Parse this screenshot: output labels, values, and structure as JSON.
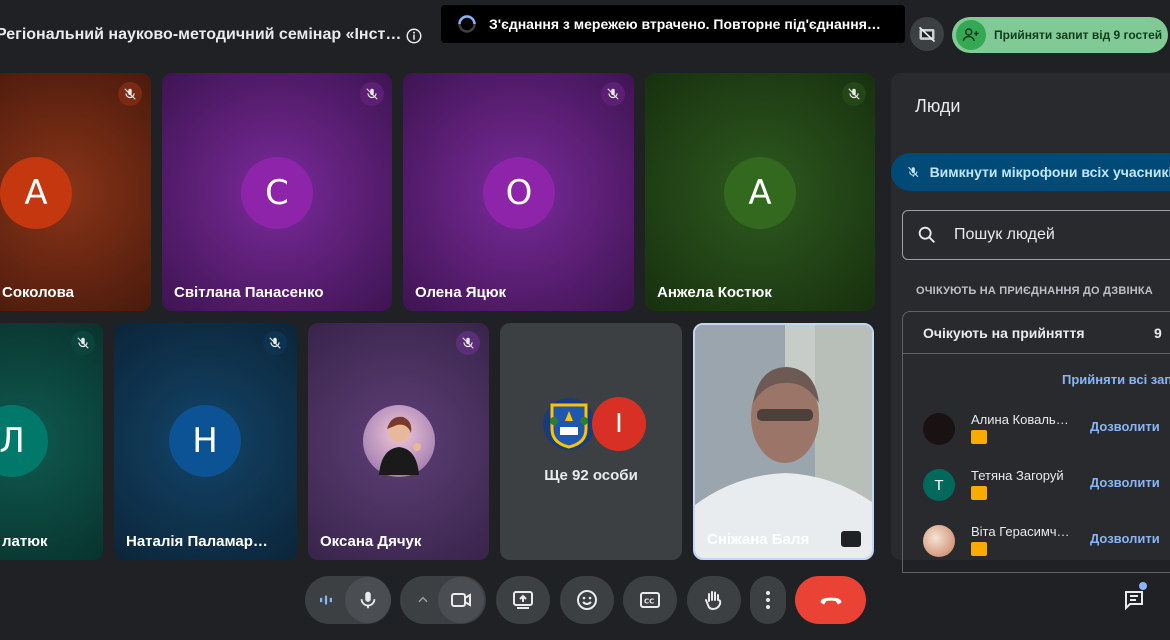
{
  "header": {
    "meeting_title": "Регіональний науково-методичний семінар «Інст…",
    "connection_banner": "З'єднання з мережею втрачено. Повторне під'єднання…",
    "admit_button": "Прийняти запит від 9 гостей"
  },
  "tiles": [
    {
      "name": "Соколова",
      "initial": "А",
      "color": "#c5370e",
      "bg": "#5e2412"
    },
    {
      "name": "Світлана Панасенко",
      "initial": "С",
      "color": "#8e24aa",
      "bg": "#4a1463"
    },
    {
      "name": "Олена Яцюк",
      "initial": "О",
      "color": "#8e24aa",
      "bg": "#4a1463"
    },
    {
      "name": "Анжела Костюк",
      "initial": "А",
      "color": "#33691e",
      "bg": "#1e3a14"
    },
    {
      "name": "латюк",
      "initial": "Л",
      "color": "#00796b",
      "bg": "#0b3d36"
    },
    {
      "name": "Наталія Паламар…",
      "initial": "Н",
      "color": "#0b5394",
      "bg": "#0e2f4a"
    },
    {
      "name": "Оксана Дячук",
      "initial": "",
      "color": "#6a3d8a",
      "bg": "#4b2f5e"
    },
    {
      "name": "Сніжана Баля",
      "initial": "",
      "color": "#555",
      "bg": "#8c8c8c"
    }
  ],
  "more_tile": {
    "label": "Ще 92 особи",
    "initial": "І",
    "color": "#d93025"
  },
  "people_panel": {
    "title": "Люди",
    "mute_all": "Вимкнути мікрофони всіх учасників",
    "search_placeholder": "Пошук людей",
    "section_label": "ОЧІКУЮТЬ НА ПРИЄДНАННЯ ДО ДЗВІНКА",
    "waiting_header": "Очікують на прийняття",
    "waiting_count": "9",
    "admit_all": "Прийняти всі запити",
    "guests": [
      {
        "name": "Алина Коваль…",
        "initial": "",
        "color": "#1a1a1a",
        "allow": "Дозволити"
      },
      {
        "name": "Тетяна Загоруй",
        "initial": "Т",
        "color": "#00695c",
        "allow": "Дозволити"
      },
      {
        "name": "Віта Герасимч…",
        "initial": "",
        "color": "#c9a07a",
        "allow": "Дозволити"
      }
    ]
  },
  "colors": {
    "end_call": "#ea4335",
    "accent": "#8ab4f8",
    "admit_bg": "#81c995"
  }
}
